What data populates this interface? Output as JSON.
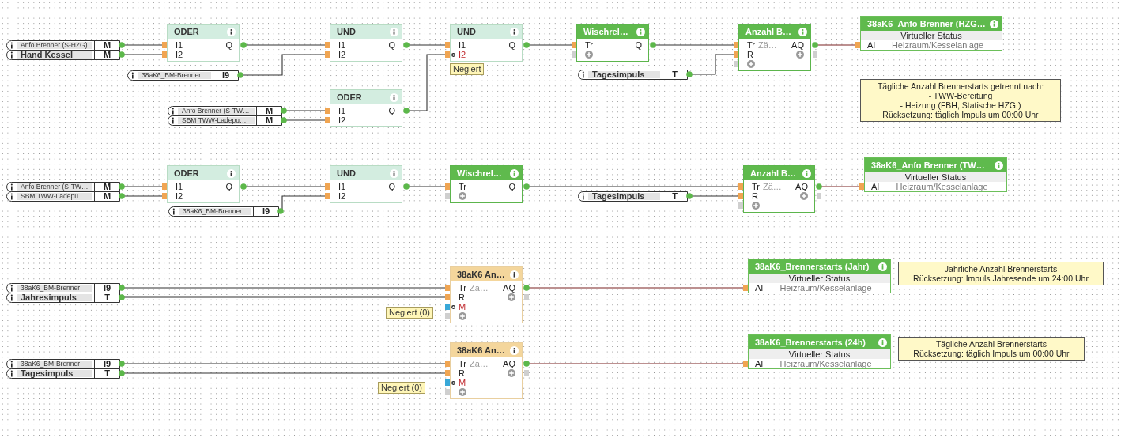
{
  "inputs": [
    {
      "label": "Anfo Brenner (S-HZG)",
      "tag": "M",
      "kind": "plain"
    },
    {
      "label": "Hand Kessel",
      "tag": "M",
      "kind": "bold"
    },
    {
      "label": "38aK6_BM-Brenner",
      "tag": "I9",
      "kind": "plain"
    },
    {
      "label": "Anfo Brenner (S-TW…",
      "tag": "M",
      "kind": "plain"
    },
    {
      "label": "SBM TWW-Ladepu…",
      "tag": "M",
      "kind": "plain"
    },
    {
      "label": "Tagesimpuls",
      "tag": "T",
      "kind": "bold"
    },
    {
      "label": "Anfo Brenner (S-TW…",
      "tag": "M",
      "kind": "plain"
    },
    {
      "label": "SBM TWW-Ladepu…",
      "tag": "M",
      "kind": "plain"
    },
    {
      "label": "38aK6_BM-Brenner",
      "tag": "I9",
      "kind": "plain"
    },
    {
      "label": "Tagesimpuls",
      "tag": "T",
      "kind": "bold"
    },
    {
      "label": "38aK6_BM-Brenner",
      "tag": "I9",
      "kind": "plain"
    },
    {
      "label": "Jahresimpuls",
      "tag": "T",
      "kind": "bold"
    },
    {
      "label": "38aK6_BM-Brenner",
      "tag": "I9",
      "kind": "plain"
    },
    {
      "label": "Tagesimpuls",
      "tag": "T",
      "kind": "bold"
    }
  ],
  "blocks": [
    {
      "title": "ODER",
      "kind": "logic",
      "inputs": [
        {
          "label": "I1",
          "negated": false
        },
        {
          "label": "I2",
          "negated": false
        }
      ],
      "outputs": [
        "Q"
      ]
    },
    {
      "title": "UND",
      "kind": "logic",
      "inputs": [
        {
          "label": "I1",
          "negated": false
        },
        {
          "label": "I2",
          "negated": false
        }
      ],
      "outputs": [
        "Q"
      ]
    },
    {
      "title": "ODER",
      "kind": "logic",
      "inputs": [
        {
          "label": "I1",
          "negated": false
        },
        {
          "label": "I2",
          "negated": false
        }
      ],
      "outputs": [
        "Q"
      ]
    },
    {
      "title": "UND",
      "kind": "logic",
      "inputs": [
        {
          "label": "I1",
          "negated": false
        },
        {
          "label": "I2",
          "negated": true
        }
      ],
      "outputs": [
        "Q"
      ],
      "note": "Negiert"
    },
    {
      "title": "Wischrel…",
      "kind": "function",
      "inputs": [
        {
          "label": "Tr",
          "negated": false
        }
      ],
      "add_input": true,
      "outputs": [
        "Q"
      ]
    },
    {
      "title": "Anzahl B…",
      "kind": "function",
      "inputs": [
        {
          "label": "Tr",
          "negated": false
        },
        {
          "label": "R",
          "negated": false
        }
      ],
      "add_input": true,
      "parameter": "Zä…",
      "outputs": [
        "AQ"
      ],
      "add_output": true
    },
    {
      "title": "ODER",
      "kind": "logic",
      "inputs": [
        {
          "label": "I1",
          "negated": false
        },
        {
          "label": "I2",
          "negated": false
        }
      ],
      "outputs": [
        "Q"
      ]
    },
    {
      "title": "UND",
      "kind": "logic",
      "inputs": [
        {
          "label": "I1",
          "negated": false
        },
        {
          "label": "I2",
          "negated": false
        }
      ],
      "outputs": [
        "Q"
      ]
    },
    {
      "title": "Wischrel…",
      "kind": "function",
      "inputs": [
        {
          "label": "Tr",
          "negated": false
        }
      ],
      "add_input": true,
      "outputs": [
        "Q"
      ]
    },
    {
      "title": "Anzahl B…",
      "kind": "function",
      "inputs": [
        {
          "label": "Tr",
          "negated": false
        },
        {
          "label": "R",
          "negated": false
        }
      ],
      "add_input": true,
      "parameter": "Zä…",
      "outputs": [
        "AQ"
      ],
      "add_output": true
    },
    {
      "title": "38aK6 An…",
      "kind": "counter",
      "inputs": [
        {
          "label": "Tr",
          "negated": false
        },
        {
          "label": "R",
          "negated": false
        },
        {
          "label": "M",
          "negated": true
        }
      ],
      "add_input": true,
      "parameter": "Zä…",
      "outputs": [
        "AQ"
      ],
      "add_output": true,
      "note": "Negiert (0)"
    },
    {
      "title": "38aK6 An…",
      "kind": "counter",
      "inputs": [
        {
          "label": "Tr",
          "negated": false
        },
        {
          "label": "R",
          "negated": false
        },
        {
          "label": "M",
          "negated": true
        }
      ],
      "add_input": true,
      "parameter": "Zä…",
      "outputs": [
        "AQ"
      ],
      "add_output": true,
      "note": "Negiert (0)"
    }
  ],
  "status_outputs": [
    {
      "title": "38aK6_Anfo Brenner (HZG…",
      "subtitle": "Virtueller Status",
      "port": "AI",
      "room": "Heizraum/Kesselanlage"
    },
    {
      "title": "38aK6_Anfo Brenner (TW…",
      "subtitle": "Virtueller Status",
      "port": "AI",
      "room": "Heizraum/Kesselanlage"
    },
    {
      "title": "38aK6_Brennerstarts (Jahr)",
      "subtitle": "Virtueller Status",
      "port": "AI",
      "room": "Heizraum/Kesselanlage"
    },
    {
      "title": "38aK6_Brennerstarts (24h)",
      "subtitle": "Virtueller Status",
      "port": "AI",
      "room": "Heizraum/Kesselanlage"
    }
  ],
  "notes": [
    {
      "text": "Tägliche Anzahl Brennerstarts getrennt nach:\n- TWW-Bereitung\n- Heizung (FBH, Statische HZG.)\nRücksetzung: täglich Impuls um 00:00 Uhr"
    },
    {
      "text": "Jährliche Anzahl Brennerstarts\nRücksetzung: Impuls Jahresende um 24:00 Uhr"
    },
    {
      "text": "Tägliche Anzahl Brennerstarts\nRücksetzung: täglich Impuls um 00:00 Uhr"
    }
  ]
}
